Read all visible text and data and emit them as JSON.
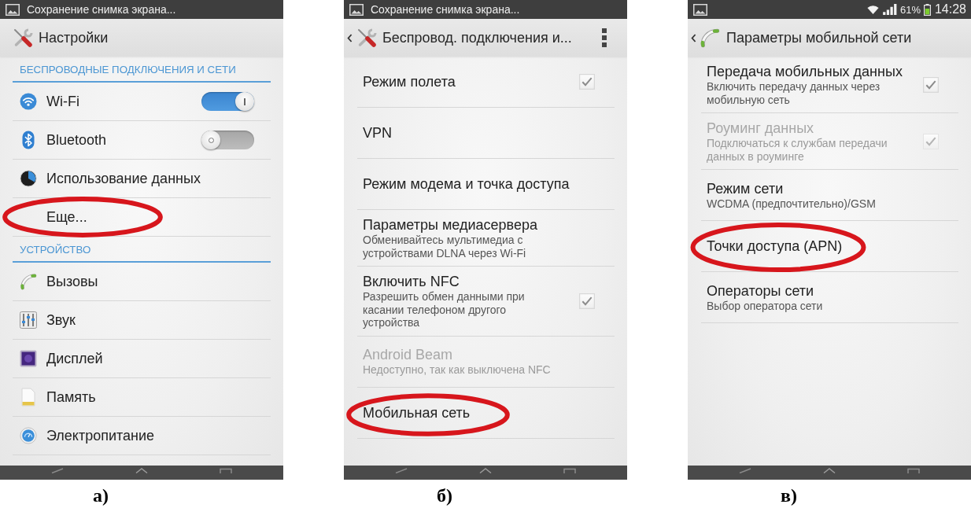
{
  "panels": [
    {
      "caption": "а)",
      "status_bar": {
        "notification": "Сохранение снимка экрана..."
      },
      "action_bar": {
        "back": false,
        "title": "Настройки",
        "overflow_menu": false
      },
      "sections": [
        {
          "header": "БЕСПРОВОДНЫЕ ПОДКЛЮЧЕНИЯ И СЕТИ",
          "items": [
            {
              "kind": "switch",
              "title": "Wi-Fi",
              "on": true,
              "circled": false
            },
            {
              "kind": "switch",
              "title": "Bluetooth",
              "on": false,
              "circled": false
            },
            {
              "kind": "plain",
              "title": "Использование данных",
              "circled": false
            },
            {
              "kind": "plain",
              "title": "Еще...",
              "circled": true
            }
          ]
        },
        {
          "header": "УСТРОЙСТВО",
          "items": [
            {
              "kind": "plain",
              "title": "Вызовы",
              "circled": false
            },
            {
              "kind": "plain",
              "title": "Звук",
              "circled": false
            },
            {
              "kind": "plain",
              "title": "Дисплей",
              "circled": false
            },
            {
              "kind": "plain",
              "title": "Память",
              "circled": false
            },
            {
              "kind": "plain",
              "title": "Электропитание",
              "circled": false
            }
          ]
        }
      ]
    },
    {
      "caption": "б)",
      "status_bar": {
        "notification": "Сохранение снимка экрана..."
      },
      "action_bar": {
        "back": true,
        "title": "Беспровод. подключения и...",
        "overflow_menu": true
      },
      "items": [
        {
          "kind": "checkbox",
          "title": "Режим полета",
          "checked": true,
          "disabled": false,
          "circled": false
        },
        {
          "kind": "plain",
          "title": "VPN",
          "disabled": false,
          "circled": false
        },
        {
          "kind": "plain",
          "title": "Режим модема и точка доступа",
          "disabled": false,
          "circled": false
        },
        {
          "kind": "plain",
          "title": "Параметры медиасервера",
          "summary": "Обменивайтесь мультимедиа с устройствами DLNA через Wi-Fi",
          "disabled": false,
          "circled": false
        },
        {
          "kind": "checkbox",
          "title": "Включить NFC",
          "summary": "Разрешить обмен данными при касании телефоном другого устройства",
          "checked": true,
          "disabled": false,
          "circled": false
        },
        {
          "kind": "plain",
          "title": "Android Beam",
          "summary": "Недоступно, так как выключена NFC",
          "disabled": true,
          "circled": false
        },
        {
          "kind": "plain",
          "title": "Мобильная сеть",
          "disabled": false,
          "circled": true
        }
      ]
    },
    {
      "caption": "в)",
      "status_bar": {
        "battery": "61%",
        "time": "14:28"
      },
      "action_bar": {
        "back": true,
        "title": "Параметры мобильной сети",
        "overflow_menu": false
      },
      "items": [
        {
          "kind": "checkbox",
          "title": "Передача мобильных данных",
          "summary": "Включить передачу данных через мобильную сеть",
          "checked": true,
          "disabled": false,
          "circled": false
        },
        {
          "kind": "checkbox",
          "title": "Роуминг данных",
          "summary": "Подключаться к службам передачи данных в роуминге",
          "checked": true,
          "disabled": true,
          "circled": false
        },
        {
          "kind": "plain",
          "title": "Режим сети",
          "summary": "WCDMA (предпочтительно)/GSM",
          "disabled": false,
          "circled": false
        },
        {
          "kind": "plain",
          "title": "Точки доступа (APN)",
          "disabled": false,
          "circled": true
        },
        {
          "kind": "plain",
          "title": "Операторы сети",
          "summary": "Выбор оператора сети",
          "disabled": false,
          "circled": false
        }
      ]
    }
  ]
}
